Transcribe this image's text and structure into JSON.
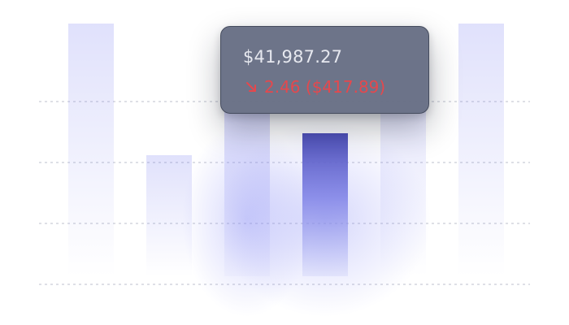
{
  "chart_data": {
    "type": "bar",
    "ylim": [
      0,
      4
    ],
    "grid": true,
    "categories": [
      "",
      "",
      "",
      "",
      "",
      ""
    ],
    "values": [
      3.9,
      2.1,
      2.7,
      2.4,
      3.4,
      3.9
    ],
    "highlight_index": 3,
    "bar_color": "#6b6de0",
    "highlight_color": "#4d4fb8"
  },
  "tooltip": {
    "price": "$41,987.27",
    "change": "2.46 ($417.89)",
    "direction": "down",
    "change_color": "#e5484d",
    "icon": "arrow-down-right-icon"
  }
}
